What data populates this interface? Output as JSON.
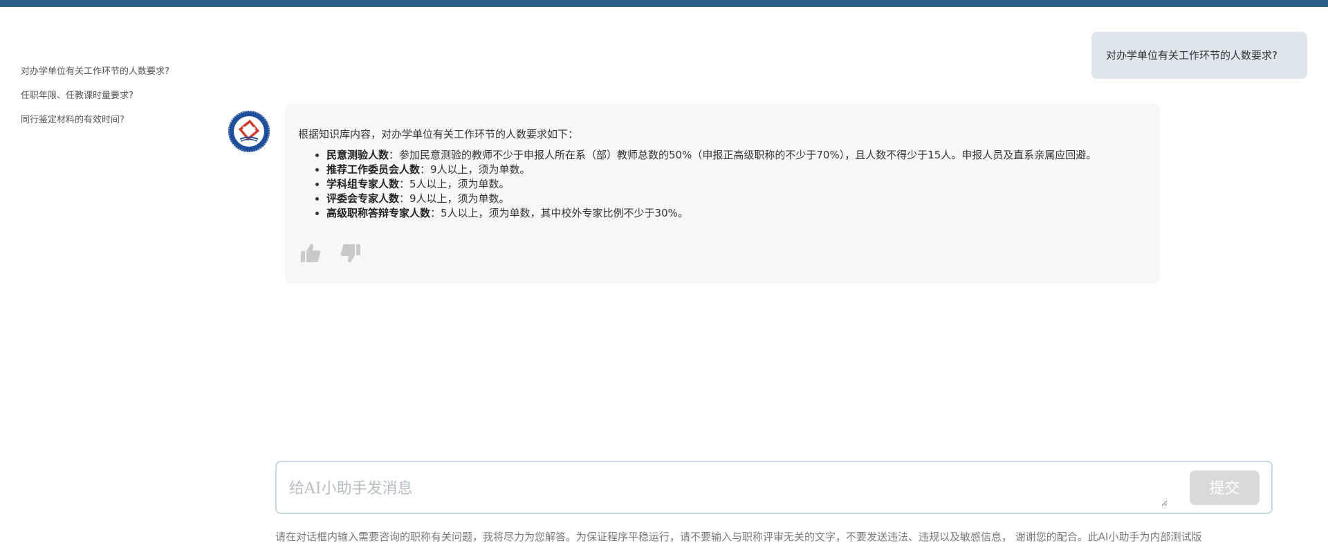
{
  "sidebar": {
    "items": [
      {
        "label": "对办学单位有关工作环节的人数要求?"
      },
      {
        "label": "任职年限、任教课时量要求?"
      },
      {
        "label": "同行鉴定材料的有效时间?"
      }
    ]
  },
  "chat": {
    "user_message": "对办学单位有关工作环节的人数要求?",
    "answer": {
      "intro": "根据知识库内容，对办学单位有关工作环节的人数要求如下：",
      "items": [
        {
          "term": "民意测验人数",
          "text": "：参加民意测验的教师不少于申报人所在系（部）教师总数的50%（申报正高级职称的不少于70%），且人数不得少于15人。申报人员及直系亲属应回避。"
        },
        {
          "term": "推荐工作委员会人数",
          "text": "：9人以上，须为单数。"
        },
        {
          "term": "学科组专家人数",
          "text": "：5人以上，须为单数。"
        },
        {
          "term": "评委会专家人数",
          "text": "：9人以上，须为单数。"
        },
        {
          "term": "高级职称答辩专家人数",
          "text": "：5人以上，须为单数，其中校外专家比例不少于30%。"
        }
      ]
    },
    "feedback": {
      "like_icon": "thumbs-up-icon",
      "dislike_icon": "thumbs-down-icon"
    }
  },
  "composer": {
    "placeholder": "给AI小助手发消息",
    "submit_label": "提交"
  },
  "disclaimer": "请在对话框内输入需要咨询的职称有关问题，我将尽力为您解答。为保证程序平稳运行，请不要输入与职称评审无关的文字，不要发送违法、违规以及敏感信息， 谢谢您的配合。此AI小助手为内部测试版",
  "colors": {
    "topbar": "#2d5e86",
    "user_bubble": "#dfe6ee",
    "answer_bg": "#f7f7f7",
    "logo_blue": "#1f4e9a",
    "logo_red": "#d23a2e"
  }
}
